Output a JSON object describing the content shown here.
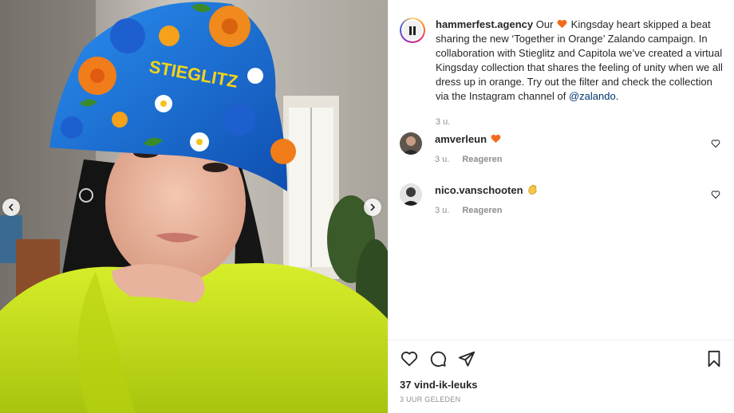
{
  "post": {
    "author": "hammerfest.agency",
    "avatar_initials": "H",
    "caption_parts": {
      "before_heart": "Our",
      "after_heart": "Kingsday heart skipped a beat sharing the new ‘Together in Orange’ Zalando campaign. In collaboration with Stieglitz and Capitola we’ve created a virtual Kingsday collection that shares the feeling of unity when we all dress up in orange. Try out the filter and check the collection via the Instagram channel of",
      "mention": "@zalando",
      "end": "."
    },
    "caption_age": "3 u.",
    "hat_text": "STIEGLITZ"
  },
  "comments": [
    {
      "username": "amverleun",
      "emoji": "heart-orange",
      "age": "3 u.",
      "reply_label": "Reageren"
    },
    {
      "username": "nico.vanschooten",
      "emoji": "clapping-hands",
      "age": "3 u.",
      "reply_label": "Reageren"
    }
  ],
  "actions": {
    "likes": "37 vind-ik-leuks",
    "timestamp": "3 UUR GELEDEN"
  },
  "colors": {
    "heart": "#f26b1d",
    "link": "#00376b",
    "muted": "#8e8e8e",
    "hat_blue": "#1a6fd6",
    "jacket": "#c6e317"
  },
  "icons": [
    "like-icon",
    "comment-icon",
    "share-icon",
    "save-icon",
    "chevron-left-icon",
    "chevron-right-icon"
  ]
}
